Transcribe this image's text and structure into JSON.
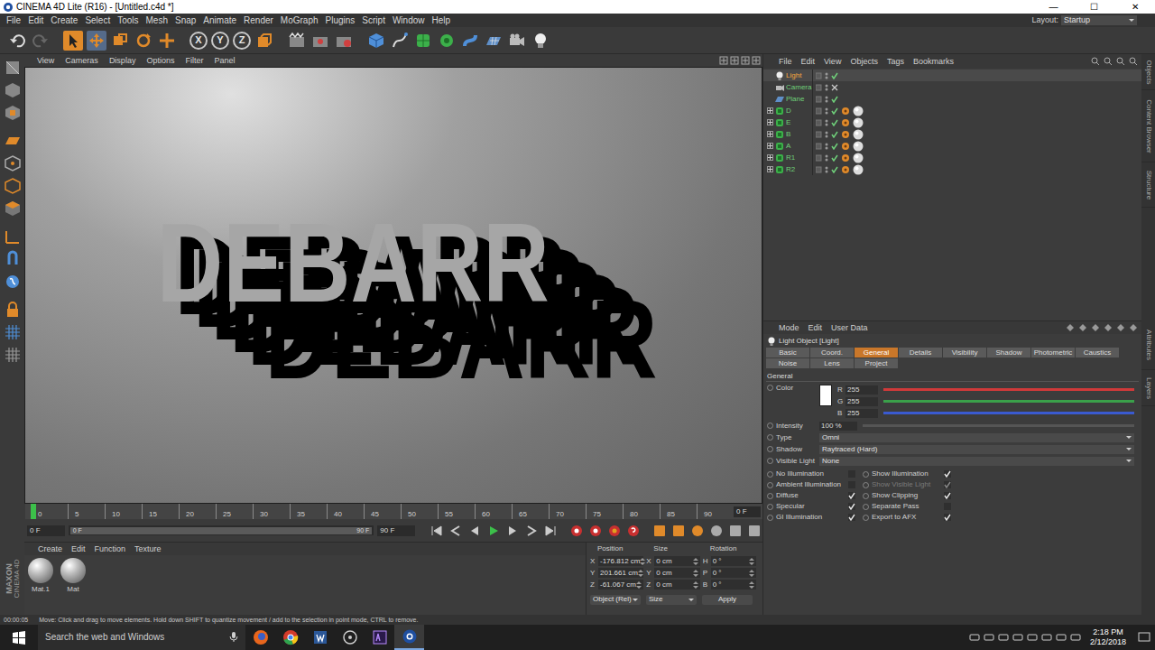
{
  "window": {
    "title": "CINEMA 4D Lite (R16) - [Untitled.c4d *]",
    "controls": [
      "—",
      "☐",
      "✕"
    ]
  },
  "menu": [
    "File",
    "Edit",
    "Create",
    "Select",
    "Tools",
    "Mesh",
    "Snap",
    "Animate",
    "Render",
    "MoGraph",
    "Plugins",
    "Script",
    "Window",
    "Help"
  ],
  "layout": {
    "label": "Layout:",
    "value": "Startup"
  },
  "toolbar": {
    "axes": [
      "X",
      "Y",
      "Z"
    ]
  },
  "logo": [
    "MAXON",
    "CINEMA 4D"
  ],
  "viewport": {
    "menu": [
      "View",
      "Cameras",
      "Display",
      "Options",
      "Filter",
      "Panel"
    ],
    "scene_text": "DEBARR"
  },
  "timeline": {
    "ticks": [
      "0",
      "5",
      "10",
      "15",
      "20",
      "25",
      "30",
      "35",
      "40",
      "45",
      "50",
      "55",
      "60",
      "65",
      "70",
      "75",
      "80",
      "85",
      "90"
    ],
    "frame_field": "0 F",
    "playhead": 0,
    "start_field": "0 F",
    "range_min": "0 F",
    "range_max": "90 F",
    "end_field": "90 F"
  },
  "materials": {
    "menu": [
      "Create",
      "Edit",
      "Function",
      "Texture"
    ],
    "items": [
      {
        "name": "Mat.1"
      },
      {
        "name": "Mat"
      }
    ]
  },
  "coordinates": {
    "headers": [
      "Position",
      "Size",
      "Rotation"
    ],
    "rows": [
      {
        "pos_axis": "X",
        "position": "-176.812 cm",
        "size_axis": "X",
        "size": "0 cm",
        "rot_axis": "H",
        "rotation": "0 °"
      },
      {
        "pos_axis": "Y",
        "position": "201.661 cm",
        "size_axis": "Y",
        "size": "0 cm",
        "rot_axis": "P",
        "rotation": "0 °"
      },
      {
        "pos_axis": "Z",
        "position": "-61.067 cm",
        "size_axis": "Z",
        "size": "0 cm",
        "rot_axis": "B",
        "rotation": "0 °"
      }
    ],
    "mode": "Object (Rel)",
    "size_mode": "Size",
    "apply": "Apply"
  },
  "objects": {
    "menu": [
      "File",
      "Edit",
      "View",
      "Objects",
      "Tags",
      "Bookmarks"
    ],
    "items": [
      {
        "name": "Light",
        "kind": "light",
        "selected": true
      },
      {
        "name": "Camera",
        "kind": "camera",
        "selected": false
      },
      {
        "name": "Plane",
        "kind": "plane",
        "selected": false
      },
      {
        "name": "D",
        "kind": "text",
        "selected": false,
        "expanded": false
      },
      {
        "name": "E",
        "kind": "text",
        "selected": false,
        "expanded": false
      },
      {
        "name": "B",
        "kind": "text",
        "selected": false,
        "expanded": false
      },
      {
        "name": "A",
        "kind": "text",
        "selected": false,
        "expanded": false
      },
      {
        "name": "R1",
        "kind": "text",
        "selected": false,
        "expanded": false
      },
      {
        "name": "R2",
        "kind": "text",
        "selected": false,
        "expanded": false
      }
    ]
  },
  "attributes": {
    "menu": [
      "Mode",
      "Edit",
      "User Data"
    ],
    "title": "Light Object [Light]",
    "tabs": [
      {
        "label": "Basic",
        "selected": false
      },
      {
        "label": "Coord.",
        "selected": false
      },
      {
        "label": "General",
        "selected": true
      },
      {
        "label": "Details",
        "selected": false
      },
      {
        "label": "Visibility",
        "selected": false
      },
      {
        "label": "Shadow",
        "selected": false
      },
      {
        "label": "Photometric",
        "selected": false
      },
      {
        "label": "Caustics",
        "selected": false
      },
      {
        "label": "Noise",
        "selected": false
      },
      {
        "label": "Lens",
        "selected": false
      },
      {
        "label": "Project",
        "selected": false
      }
    ],
    "section": "General",
    "color": {
      "label": "Color",
      "swatch": "#ffffff",
      "channels": [
        {
          "name": "R",
          "value": "255",
          "level": 1,
          "color": "#d03a3a"
        },
        {
          "name": "G",
          "value": "255",
          "level": 1,
          "color": "#3aa04a"
        },
        {
          "name": "B",
          "value": "255",
          "level": 1,
          "color": "#3a5ad0"
        }
      ]
    },
    "intensity": {
      "label": "Intensity",
      "value": "100 %"
    },
    "dropdowns": [
      {
        "label": "Type",
        "value": "Omni"
      },
      {
        "label": "Shadow",
        "value": "Raytraced (Hard)"
      },
      {
        "label": "Visible Light",
        "value": "None"
      }
    ],
    "checks": {
      "left": [
        {
          "label": "No Illumination",
          "checked": false,
          "disabled": false
        },
        {
          "label": "Ambient Illumination",
          "checked": false,
          "disabled": false
        },
        {
          "label": "Diffuse",
          "checked": true,
          "disabled": false
        },
        {
          "label": "Specular",
          "checked": true,
          "disabled": false
        },
        {
          "label": "GI Illumination",
          "checked": true,
          "disabled": false
        }
      ],
      "right": [
        {
          "label": "Show Illumination",
          "checked": true,
          "disabled": false
        },
        {
          "label": "Show Visible Light",
          "checked": true,
          "disabled": true
        },
        {
          "label": "Show Clipping",
          "checked": true,
          "disabled": false
        },
        {
          "label": "Separate Pass",
          "checked": false,
          "disabled": false
        },
        {
          "label": "Export to AFX",
          "checked": true,
          "disabled": false
        }
      ]
    }
  },
  "side_tabs": {
    "upper": [
      "Objects",
      "Content Browser",
      "Structure"
    ],
    "lower": [
      "Attributes",
      "Layers"
    ]
  },
  "status_bar": {
    "time": "00:00:05",
    "message": "Move: Click and drag to move elements. Hold down SHIFT to quantize movement / add to the selection in point mode, CTRL to remove."
  },
  "taskbar": {
    "search": "Search the web and Windows",
    "time": "2:18 PM",
    "date": "2/12/2018"
  }
}
